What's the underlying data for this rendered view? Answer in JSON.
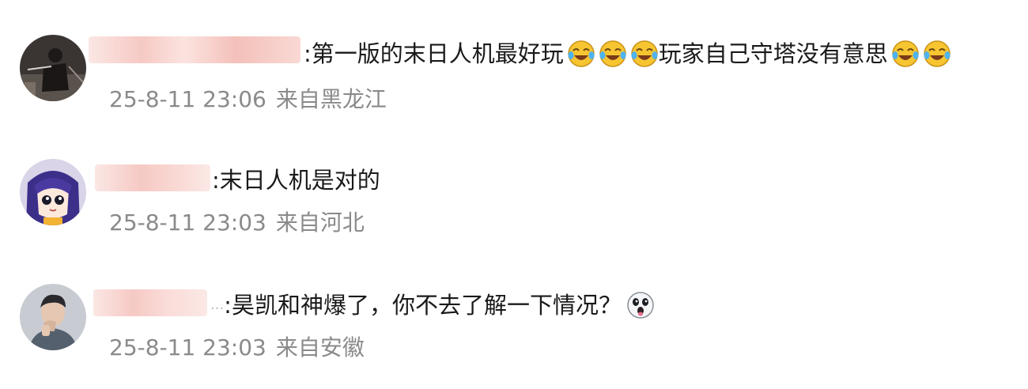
{
  "comments": [
    {
      "avatar_icon": "avatar-dark-figure-icon",
      "segments": [
        {
          "text": ":第一版的末日人机最好玩"
        },
        {
          "emoji": "laugh-cry-icon"
        },
        {
          "emoji": "laugh-cry-icon"
        },
        {
          "emoji": "laugh-cry-icon"
        },
        {
          "text": "玩家自己守塔没有意思"
        },
        {
          "emoji": "laugh-cry-icon"
        },
        {
          "emoji": "laugh-cry-icon"
        }
      ],
      "text_1": ":第一版的末日人机最好玩",
      "text_2": "玩家自己守塔没有意思",
      "timestamp": "25-8-11 23:06",
      "location": "来自黑龙江"
    },
    {
      "avatar_icon": "avatar-anime-girl-icon",
      "text_1": ":末日人机是对的",
      "timestamp": "25-8-11 23:03",
      "location": "来自河北"
    },
    {
      "avatar_icon": "avatar-man-portrait-icon",
      "name_suffix": "...",
      "text_1": ":昊凯和神爆了，你不去了解一下情况？",
      "timestamp": "25-8-11 23:03",
      "location": "来自安徽"
    }
  ],
  "colors": {
    "text": "#1a1a1a",
    "meta": "#8a8a8a",
    "blur": "#f6c9c4",
    "emoji_face": "#f7c531"
  }
}
